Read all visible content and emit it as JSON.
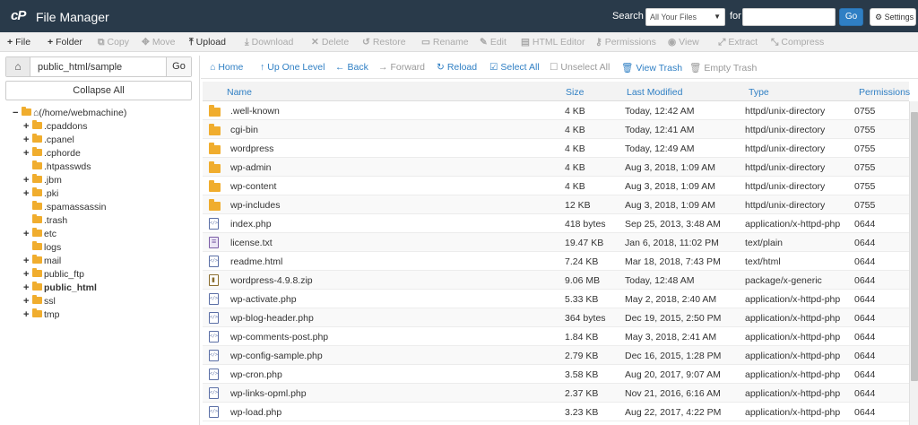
{
  "header": {
    "logo": "cP",
    "title": "File Manager",
    "search_label": "Search",
    "search_scope": "All Your Files",
    "for_label": "for",
    "search_query": "",
    "go_label": "Go",
    "settings_label": "Settings"
  },
  "toolbar": {
    "file": "File",
    "folder": "Folder",
    "copy": "Copy",
    "move": "Move",
    "upload": "Upload",
    "download": "Download",
    "delete": "Delete",
    "restore": "Restore",
    "rename": "Rename",
    "edit": "Edit",
    "html_editor": "HTML Editor",
    "permissions": "Permissions",
    "view": "View",
    "extract": "Extract",
    "compress": "Compress"
  },
  "path": {
    "value": "public_html/sample",
    "go_label": "Go",
    "collapse_all": "Collapse All"
  },
  "tree": {
    "root": "(/home/webmachine)",
    "items": [
      {
        "label": ".cpaddons",
        "expandable": true
      },
      {
        "label": ".cpanel",
        "expandable": true
      },
      {
        "label": ".cphorde",
        "expandable": true
      },
      {
        "label": ".htpasswds",
        "expandable": false
      },
      {
        "label": ".jbm",
        "expandable": true
      },
      {
        "label": ".pki",
        "expandable": true
      },
      {
        "label": ".spamassassin",
        "expandable": false
      },
      {
        "label": ".trash",
        "expandable": false
      },
      {
        "label": "etc",
        "expandable": true
      },
      {
        "label": "logs",
        "expandable": false
      },
      {
        "label": "mail",
        "expandable": true
      },
      {
        "label": "public_ftp",
        "expandable": true
      },
      {
        "label": "public_html",
        "expandable": true,
        "selected": true
      },
      {
        "label": "ssl",
        "expandable": true
      },
      {
        "label": "tmp",
        "expandable": true
      }
    ]
  },
  "nav": {
    "home": "Home",
    "up": "Up One Level",
    "back": "Back",
    "forward": "Forward",
    "reload": "Reload",
    "select_all": "Select All",
    "unselect_all": "Unselect All",
    "view_trash": "View Trash",
    "empty_trash": "Empty Trash"
  },
  "table": {
    "headers": {
      "name": "Name",
      "size": "Size",
      "modified": "Last Modified",
      "type": "Type",
      "permissions": "Permissions"
    },
    "rows": [
      {
        "icon": "folder",
        "name": ".well-known",
        "size": "4 KB",
        "modified": "Today, 12:42 AM",
        "type": "httpd/unix-directory",
        "perm": "0755"
      },
      {
        "icon": "folder",
        "name": "cgi-bin",
        "size": "4 KB",
        "modified": "Today, 12:41 AM",
        "type": "httpd/unix-directory",
        "perm": "0755"
      },
      {
        "icon": "folder",
        "name": "wordpress",
        "size": "4 KB",
        "modified": "Today, 12:49 AM",
        "type": "httpd/unix-directory",
        "perm": "0755"
      },
      {
        "icon": "folder",
        "name": "wp-admin",
        "size": "4 KB",
        "modified": "Aug 3, 2018, 1:09 AM",
        "type": "httpd/unix-directory",
        "perm": "0755"
      },
      {
        "icon": "folder",
        "name": "wp-content",
        "size": "4 KB",
        "modified": "Aug 3, 2018, 1:09 AM",
        "type": "httpd/unix-directory",
        "perm": "0755"
      },
      {
        "icon": "folder",
        "name": "wp-includes",
        "size": "12 KB",
        "modified": "Aug 3, 2018, 1:09 AM",
        "type": "httpd/unix-directory",
        "perm": "0755"
      },
      {
        "icon": "code",
        "name": "index.php",
        "size": "418 bytes",
        "modified": "Sep 25, 2013, 3:48 AM",
        "type": "application/x-httpd-php",
        "perm": "0644"
      },
      {
        "icon": "text",
        "name": "license.txt",
        "size": "19.47 KB",
        "modified": "Jan 6, 2018, 11:02 PM",
        "type": "text/plain",
        "perm": "0644"
      },
      {
        "icon": "code",
        "name": "readme.html",
        "size": "7.24 KB",
        "modified": "Mar 18, 2018, 7:43 PM",
        "type": "text/html",
        "perm": "0644"
      },
      {
        "icon": "zip",
        "name": "wordpress-4.9.8.zip",
        "size": "9.06 MB",
        "modified": "Today, 12:48 AM",
        "type": "package/x-generic",
        "perm": "0644"
      },
      {
        "icon": "code",
        "name": "wp-activate.php",
        "size": "5.33 KB",
        "modified": "May 2, 2018, 2:40 AM",
        "type": "application/x-httpd-php",
        "perm": "0644"
      },
      {
        "icon": "code",
        "name": "wp-blog-header.php",
        "size": "364 bytes",
        "modified": "Dec 19, 2015, 2:50 PM",
        "type": "application/x-httpd-php",
        "perm": "0644"
      },
      {
        "icon": "code",
        "name": "wp-comments-post.php",
        "size": "1.84 KB",
        "modified": "May 3, 2018, 2:41 AM",
        "type": "application/x-httpd-php",
        "perm": "0644"
      },
      {
        "icon": "code",
        "name": "wp-config-sample.php",
        "size": "2.79 KB",
        "modified": "Dec 16, 2015, 1:28 PM",
        "type": "application/x-httpd-php",
        "perm": "0644"
      },
      {
        "icon": "code",
        "name": "wp-cron.php",
        "size": "3.58 KB",
        "modified": "Aug 20, 2017, 9:07 AM",
        "type": "application/x-httpd-php",
        "perm": "0644"
      },
      {
        "icon": "code",
        "name": "wp-links-opml.php",
        "size": "2.37 KB",
        "modified": "Nov 21, 2016, 6:16 AM",
        "type": "application/x-httpd-php",
        "perm": "0644"
      },
      {
        "icon": "code",
        "name": "wp-load.php",
        "size": "3.23 KB",
        "modified": "Aug 22, 2017, 4:22 PM",
        "type": "application/x-httpd-php",
        "perm": "0644"
      }
    ]
  }
}
